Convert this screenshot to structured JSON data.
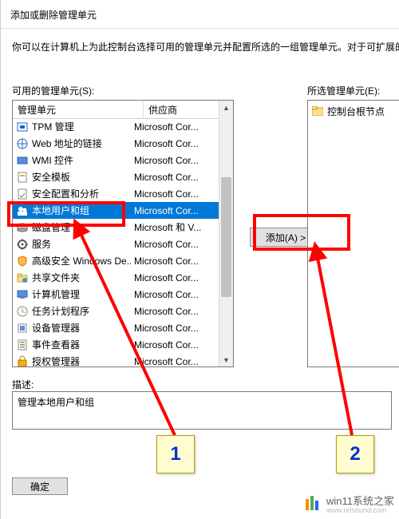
{
  "dialog": {
    "title": "添加或删除管理单元",
    "instruction": "你可以在计算机上为此控制台选择可用的管理单元并配置所选的一组管理单元。对于可扩展的"
  },
  "available": {
    "label": "可用的管理单元(S):",
    "col1": "管理单元",
    "col2": "供应商",
    "rows": [
      {
        "icon": "tpm",
        "name": "TPM 管理",
        "vendor": "Microsoft Cor..."
      },
      {
        "icon": "weblink",
        "name": "Web 地址的链接",
        "vendor": "Microsoft Cor..."
      },
      {
        "icon": "wmi",
        "name": "WMI 控件",
        "vendor": "Microsoft Cor..."
      },
      {
        "icon": "sectmpl",
        "name": "安全模板",
        "vendor": "Microsoft Cor..."
      },
      {
        "icon": "secanal",
        "name": "安全配置和分析",
        "vendor": "Microsoft Cor..."
      },
      {
        "icon": "users",
        "name": "本地用户和组",
        "vendor": "Microsoft Cor...",
        "selected": true
      },
      {
        "icon": "disk",
        "name": "磁盘管理",
        "vendor": "Microsoft 和 V..."
      },
      {
        "icon": "services",
        "name": "服务",
        "vendor": "Microsoft Cor..."
      },
      {
        "icon": "defender",
        "name": "高级安全 Windows De...",
        "vendor": "Microsoft Cor..."
      },
      {
        "icon": "share",
        "name": "共享文件夹",
        "vendor": "Microsoft Cor..."
      },
      {
        "icon": "cmgmt",
        "name": "计算机管理",
        "vendor": "Microsoft Cor..."
      },
      {
        "icon": "tasks",
        "name": "任务计划程序",
        "vendor": "Microsoft Cor..."
      },
      {
        "icon": "devmgr",
        "name": "设备管理器",
        "vendor": "Microsoft Cor..."
      },
      {
        "icon": "eventvwr",
        "name": "事件查看器",
        "vendor": "Microsoft Cor..."
      },
      {
        "icon": "authmgr",
        "name": "授权管理器",
        "vendor": "Microsoft Cor..."
      }
    ]
  },
  "selected": {
    "label": "所选管理单元(E):",
    "root": "控制台根节点"
  },
  "buttons": {
    "add": "添加(A) >",
    "ok": "确定"
  },
  "description": {
    "label": "描述:",
    "text": "管理本地用户和组"
  },
  "annotations": {
    "step1": "1",
    "step2": "2"
  },
  "watermark": {
    "main": "win11系统之家",
    "sub": "www.relsound.com"
  }
}
